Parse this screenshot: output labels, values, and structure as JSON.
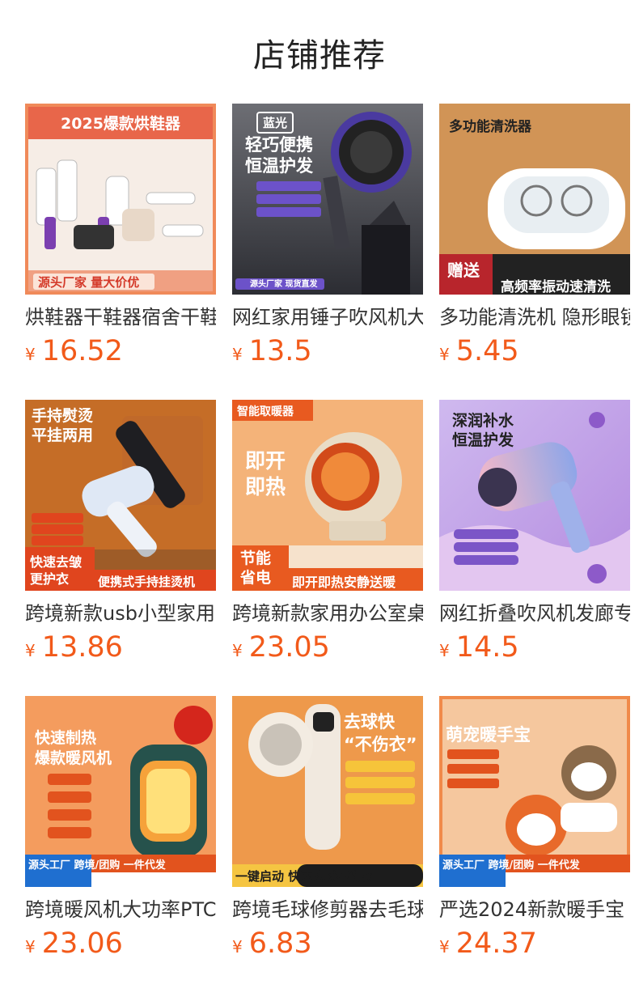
{
  "page": {
    "title": "店铺推荐"
  },
  "products": [
    {
      "name": "烘鞋器干鞋器宿舍干鞋",
      "currency": "¥",
      "price": "16.52",
      "image_text": {
        "headline": "2025爆款烘鞋器",
        "footer": "源头厂家 量大价优"
      }
    },
    {
      "name": "网红家用锤子吹风机大",
      "currency": "¥",
      "price": "13.5",
      "image_text": {
        "badge": "蓝光",
        "headline": "轻巧便携\n恒温护发",
        "footer": "源头厂家 现货直发"
      }
    },
    {
      "name": "多功能清洗机 隐形眼镜",
      "currency": "¥",
      "price": "5.45",
      "image_text": {
        "headline": "多功能清洗器",
        "badge": "赠送",
        "footer": "高频率振动速清洗"
      }
    },
    {
      "name": "跨境新款usb小型家用",
      "currency": "¥",
      "price": "13.86",
      "image_text": {
        "headline": "手持熨烫\n平挂两用",
        "badge": "快速去皱\n更护衣",
        "footer": "便携式手持挂烫机"
      }
    },
    {
      "name": "跨境新款家用办公室桌",
      "currency": "¥",
      "price": "23.05",
      "image_text": {
        "badge": "智能取暖器",
        "headline": "即开\n即热",
        "footer": "节能\n省电",
        "footer2": "即开即热安静送暖"
      }
    },
    {
      "name": "网红折叠吹风机发廊专",
      "currency": "¥",
      "price": "14.5",
      "image_text": {
        "headline": "深润补水\n恒温护发"
      }
    },
    {
      "name": "跨境暖风机大功率PTC",
      "currency": "¥",
      "price": "23.06",
      "image_text": {
        "headline": "快速制热\n爆款暖风机",
        "footer": "源头工厂 跨境/团购 一件代发"
      }
    },
    {
      "name": "跨境毛球修剪器去毛球",
      "currency": "¥",
      "price": "6.83",
      "image_text": {
        "headline": "去球快\n“不伤衣”",
        "footer": "一键启动 快速去球不伤衣"
      }
    },
    {
      "name": "严选2024新款暖手宝",
      "currency": "¥",
      "price": "24.37",
      "image_text": {
        "headline": "萌宠暖手宝",
        "footer": "源头工厂 跨境/团购 一件代发"
      }
    }
  ],
  "colors": {
    "price": "#f25a1a",
    "title": "#222222"
  }
}
